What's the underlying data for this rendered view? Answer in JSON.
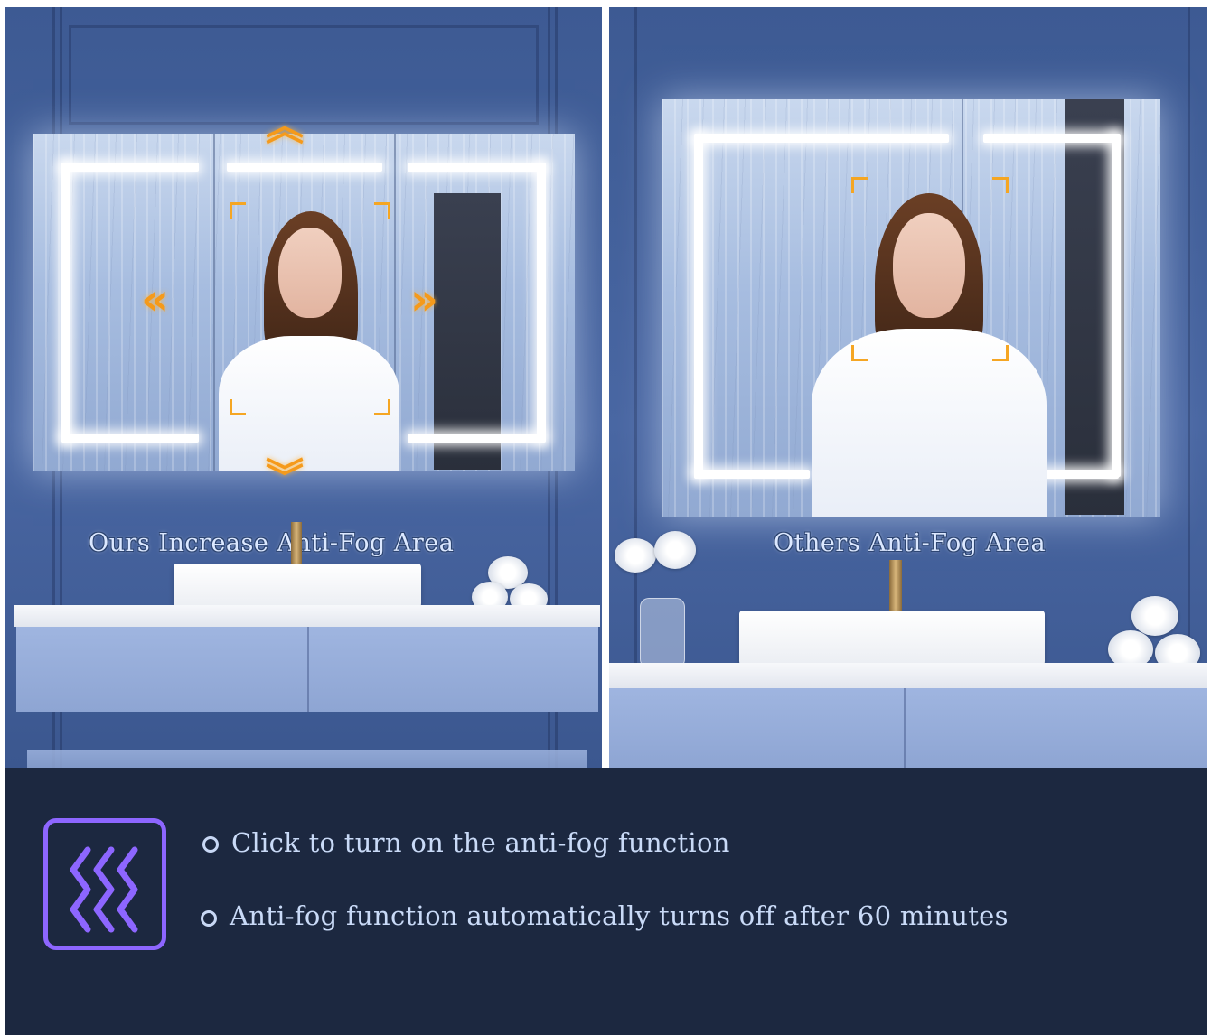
{
  "comparison": {
    "ours_label": "Ours Increase Anti-Fog Area",
    "others_label": "Others Anti-Fog Area"
  },
  "features": {
    "icon": "anti-fog-heat-waves-icon",
    "items": [
      "Click to turn on the anti-fog function",
      "Anti-fog function automatically turns off after 60 minutes"
    ]
  },
  "colors": {
    "accent_orange": "#f59a1b",
    "icon_purple": "#8d66ff",
    "bottom_band": "#1c2840",
    "wall_blue": "#4a67a3"
  }
}
